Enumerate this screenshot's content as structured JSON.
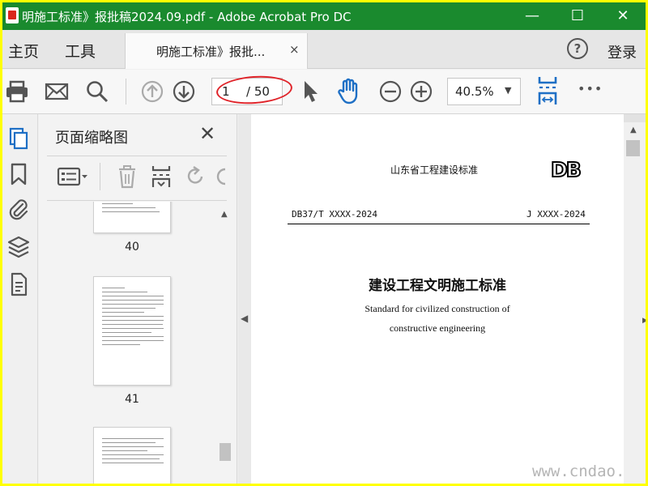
{
  "window": {
    "title": "明施工标准》报批稿2024.09.pdf - Adobe Acrobat Pro DC",
    "minimize": "—",
    "maximize": "☐",
    "close": "✕"
  },
  "menubar": {
    "home": "主页",
    "tools": "工具",
    "doc_tab_label": "明施工标准》报批...",
    "doc_tab_close": "×",
    "help": "?",
    "login": "登录"
  },
  "toolbar": {
    "page_current": "1",
    "page_total": "/ 50",
    "zoom": "40.5%",
    "zoom_arrow": "▼",
    "more": "•••",
    "icons": [
      "print-icon",
      "mail-icon",
      "search-icon",
      "page-up-icon",
      "page-down-icon",
      "select-cursor-icon",
      "hand-icon",
      "zoom-out-icon",
      "zoom-in-icon",
      "fit-page-icon",
      "more-icon"
    ]
  },
  "rail": {
    "icons": [
      "page-thumbnails-icon",
      "bookmark-icon",
      "attachment-icon",
      "layers-icon",
      "document-properties-icon"
    ]
  },
  "thumbnails_panel": {
    "title": "页面缩略图",
    "close": "✕",
    "pages": [
      {
        "label": "40"
      },
      {
        "label": "41"
      }
    ]
  },
  "document": {
    "header": "山东省工程建设标准",
    "logo": "DB",
    "standard_no": "DB37/T XXXX-2024",
    "j_no": "J XXXX-2024",
    "title": "建设工程文明施工标准",
    "subtitle_line1": "Standard for civilized construction of",
    "subtitle_line2": "constructive engineering"
  },
  "watermark": "www.cndao.com",
  "colors": {
    "titlebar": "#1a8a2e",
    "highlight_ellipse": "#e0242a",
    "icon_blue": "#1e6fc5",
    "frame_border": "#ffff00"
  }
}
